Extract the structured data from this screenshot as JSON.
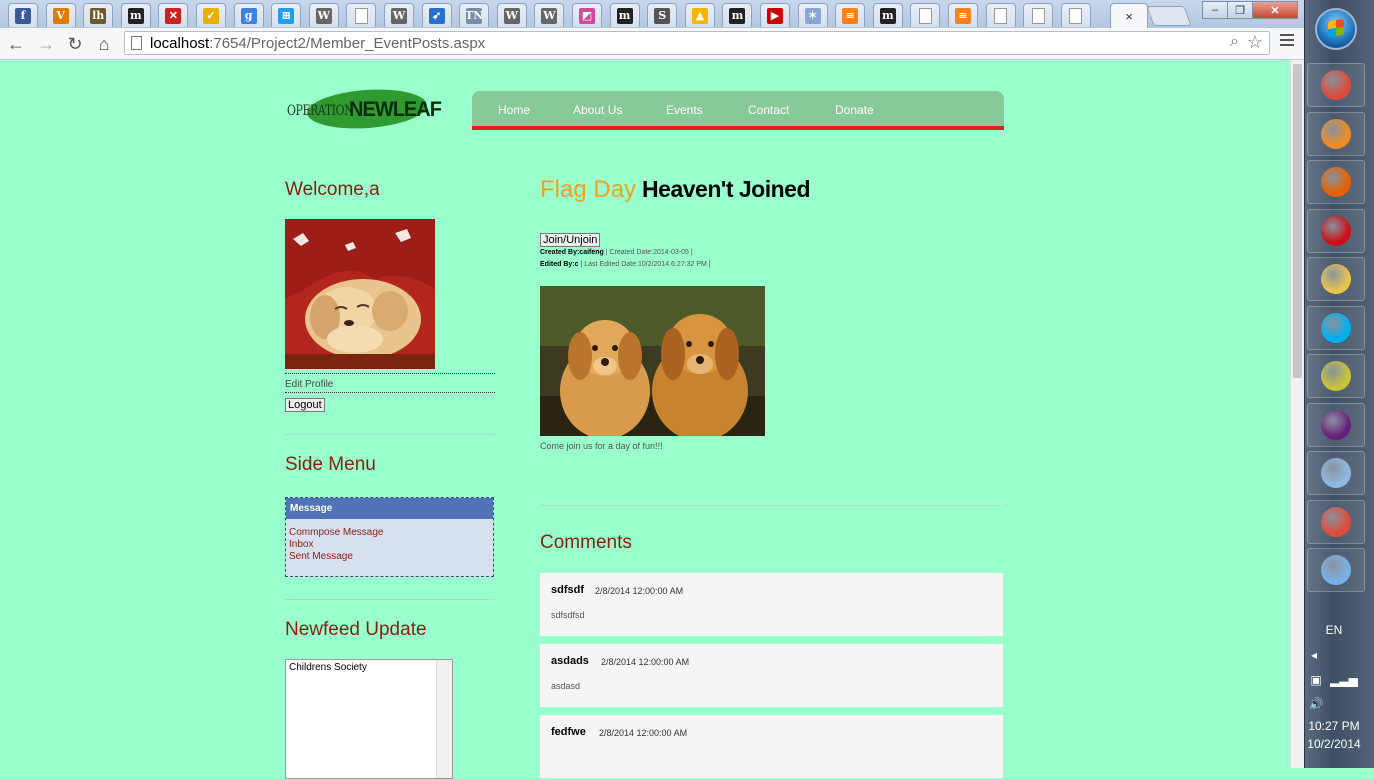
{
  "browser": {
    "tabs": [
      {
        "icon": "facebook-icon",
        "glyph": "f",
        "color": "#3b5998"
      },
      {
        "icon": "v-icon",
        "glyph": "V",
        "color": "#e07b00"
      },
      {
        "icon": "lh-icon",
        "glyph": "lh",
        "color": "#6b5a2e"
      },
      {
        "icon": "m-icon",
        "glyph": "m",
        "color": "#222222"
      },
      {
        "icon": "x-icon",
        "glyph": "✕",
        "color": "#d02020"
      },
      {
        "icon": "check-icon",
        "glyph": "✓",
        "color": "#e8b100"
      },
      {
        "icon": "google-icon",
        "glyph": "g",
        "color": "#3f7fe8"
      },
      {
        "icon": "windows-icon",
        "glyph": "⊞",
        "color": "#21a0e8"
      },
      {
        "icon": "wikipedia-icon",
        "glyph": "W",
        "color": "#666666"
      },
      {
        "icon": "blank-page-icon",
        "glyph": "",
        "color": "#ffffff"
      },
      {
        "icon": "wikipedia-icon",
        "glyph": "W",
        "color": "#666666"
      },
      {
        "icon": "bird-icon",
        "glyph": "➶",
        "color": "#2a6fd0"
      },
      {
        "icon": "tn-icon",
        "glyph": "TN",
        "color": "#7a8da8"
      },
      {
        "icon": "wikipedia-icon",
        "glyph": "W",
        "color": "#666666"
      },
      {
        "icon": "wikipedia-icon",
        "glyph": "W",
        "color": "#666666"
      },
      {
        "icon": "chart-icon",
        "glyph": "◩",
        "color": "#d6479a"
      },
      {
        "icon": "m-icon",
        "glyph": "m",
        "color": "#222222"
      },
      {
        "icon": "st-icon",
        "glyph": "S",
        "color": "#555555"
      },
      {
        "icon": "drive-icon",
        "glyph": "▲",
        "color": "#f4b400"
      },
      {
        "icon": "m-icon",
        "glyph": "m",
        "color": "#222222"
      },
      {
        "icon": "youtube-icon",
        "glyph": "▶",
        "color": "#cc0000"
      },
      {
        "icon": "star-icon",
        "glyph": "✶",
        "color": "#8aa6d8"
      },
      {
        "icon": "stackoverflow-icon",
        "glyph": "≡",
        "color": "#f48024"
      },
      {
        "icon": "m-icon",
        "glyph": "m",
        "color": "#222222"
      },
      {
        "icon": "blank-page-icon",
        "glyph": "",
        "color": "#ffffff"
      },
      {
        "icon": "stackoverflow-icon",
        "glyph": "≡",
        "color": "#f48024"
      },
      {
        "icon": "blank-page-icon",
        "glyph": "",
        "color": "#ffffff"
      },
      {
        "icon": "blank-page-icon",
        "glyph": "",
        "color": "#ffffff"
      },
      {
        "icon": "blank-page-icon",
        "glyph": "",
        "color": "#ffffff"
      }
    ],
    "url_host": "localhost",
    "url_path": ":7654/Project2/Member_EventPosts.aspx",
    "active_tab_close": "×"
  },
  "site": {
    "logo_left": "OPERATION",
    "logo_right": "NEWLEAF",
    "nav": [
      "Home",
      "About Us",
      "Events",
      "Contact",
      "Donate"
    ],
    "accent_red": "#e0201e"
  },
  "sidebar": {
    "welcome": "Welcome,a",
    "edit_profile": "Edit Profile",
    "logout": "Logout",
    "side_menu_title": "Side Menu",
    "message_header": "Message",
    "message_links": [
      "Commpose Message",
      "Inbox",
      "Sent Message"
    ],
    "newsfeed_title": "Newfeed Update",
    "newsfeed_items": [
      "Childrens Society"
    ]
  },
  "event": {
    "title": "Flag Day",
    "status": "Heaven't Joined",
    "join_button": "Join/Unjoin",
    "created_by_label": "Created By:",
    "created_by": "caifeng",
    "created_date": "| Created Date:2014-03-05 |",
    "edited_by_label": "Edited By:",
    "edited_by": "c",
    "edited_date": "| Last Edited Date:10/2/2014 6:27:32 PM |",
    "description": "Come join us for a day of fun!!!"
  },
  "comments": {
    "title": "Comments",
    "items": [
      {
        "author": "sdfsdf",
        "date": "2/8/2014 12:00:00 AM",
        "body": "sdfsdfsd"
      },
      {
        "author": "asdads",
        "date": "2/8/2014 12:00:00 AM",
        "body": "asdasd"
      },
      {
        "author": "fedfwe",
        "date": "2/8/2014 12:00:00 AM",
        "body": ""
      }
    ]
  },
  "taskbar": {
    "apps": [
      {
        "name": "chrome-icon",
        "color": "#dd4b39"
      },
      {
        "name": "media-player-icon",
        "color": "#f08a24"
      },
      {
        "name": "firefox-icon",
        "color": "#e66000"
      },
      {
        "name": "opera-icon",
        "color": "#cc0f16"
      },
      {
        "name": "file-explorer-icon",
        "color": "#e9c34f"
      },
      {
        "name": "skype-icon",
        "color": "#00aff0"
      },
      {
        "name": "tools-icon",
        "color": "#c9c23a"
      },
      {
        "name": "visual-studio-icon",
        "color": "#68217a"
      },
      {
        "name": "notepad-icon",
        "color": "#8fb8e0"
      },
      {
        "name": "chrome-icon",
        "color": "#dd4b39"
      },
      {
        "name": "paint-icon",
        "color": "#7ab0e8"
      }
    ],
    "lang": "EN",
    "time": "10:27 PM",
    "date": "10/2/2014"
  }
}
